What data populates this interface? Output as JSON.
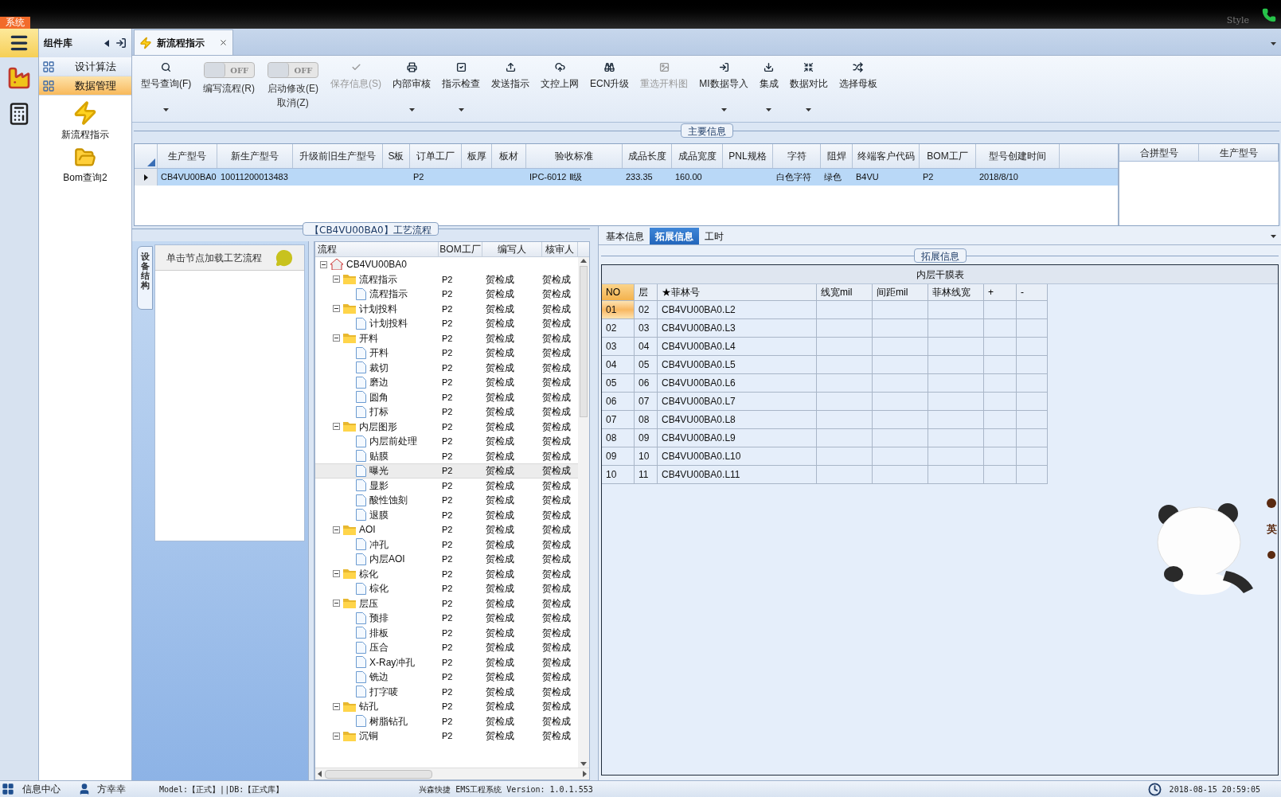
{
  "header": {
    "system_tab": "系统",
    "style_label": "Style"
  },
  "component_library": {
    "title": "组件库",
    "items": [
      {
        "label": "设计算法",
        "selected": false
      },
      {
        "label": "数据管理",
        "selected": true
      }
    ],
    "shortcuts": [
      {
        "label": "新流程指示",
        "kind": "bolt"
      },
      {
        "label": "Bom查询2",
        "kind": "folder"
      }
    ]
  },
  "document_tabs": [
    {
      "label": "新流程指示",
      "selected": true
    }
  ],
  "toolbar": [
    {
      "label": "型号查询(F)",
      "kind": "button",
      "disabled": false,
      "has_menu": true
    },
    {
      "label": "编写流程(R)",
      "kind": "toggle",
      "toggle_text": "OFF",
      "on": false
    },
    {
      "label": "启动修改(E)",
      "sublabel": "取消(Z)",
      "kind": "toggle",
      "toggle_text": "OFF",
      "on": false
    },
    {
      "label": "保存信息(S)",
      "kind": "button",
      "disabled": true,
      "has_menu": false
    },
    {
      "label": "内部审核",
      "kind": "button",
      "disabled": false,
      "has_menu": true
    },
    {
      "label": "指示检查",
      "kind": "button",
      "disabled": false,
      "has_menu": true
    },
    {
      "label": "发送指示",
      "kind": "button",
      "disabled": false,
      "has_menu": false
    },
    {
      "label": "文控上网",
      "kind": "button",
      "disabled": false,
      "has_menu": false
    },
    {
      "label": "ECN升级",
      "kind": "button",
      "disabled": false,
      "has_menu": false
    },
    {
      "label": "重选开料图",
      "kind": "button",
      "disabled": true,
      "has_menu": false
    },
    {
      "label": "MI数据导入",
      "kind": "button",
      "disabled": false,
      "has_menu": true
    },
    {
      "label": "集成",
      "kind": "button",
      "disabled": false,
      "has_menu": true
    },
    {
      "label": "数据对比",
      "kind": "button",
      "disabled": false,
      "has_menu": true
    },
    {
      "label": "选择母板",
      "kind": "button",
      "disabled": false,
      "has_menu": false
    }
  ],
  "main_info": {
    "title": "主要信息",
    "columns": [
      "生产型号",
      "新生产型号",
      "升级前旧生产型号",
      "S板",
      "订单工厂",
      "板厚",
      "板材",
      "验收标准",
      "成品长度",
      "成品宽度",
      "PNL规格",
      "字符",
      "阻焊",
      "终端客户代码",
      "BOM工厂",
      "型号创建时间"
    ],
    "rows": [
      {
        "selected": true,
        "cells": [
          "CB4VU00BA0",
          "10011200013483",
          null,
          null,
          "P2",
          null,
          null,
          "IPC-6012 Ⅱ级",
          "233.35",
          "160.00",
          null,
          "白色字符",
          "绿色",
          "B4VU",
          "P2",
          "2018/8/10"
        ]
      }
    ],
    "merge_table": {
      "columns": [
        "合拼型号",
        "生产型号"
      ]
    }
  },
  "process_panel": {
    "title": "【CB4VU00BA0】工艺流程",
    "side_tab": "设备结构",
    "hint": "单击节点加载工艺流程",
    "columns": [
      "流程",
      "BOM工厂",
      "编写人",
      "核审人"
    ],
    "tree": {
      "label": "CB4VU00BA0",
      "expanded": true,
      "selected": false,
      "children": [
        {
          "label": "流程指示",
          "bom": "P2",
          "author": "贺检成",
          "reviewer": "贺检成",
          "expanded": true,
          "selected": false,
          "children": [
            {
              "label": "流程指示",
              "bom": "P2",
              "author": "贺检成",
              "reviewer": "贺检成",
              "selected": false
            }
          ]
        },
        {
          "label": "计划投料",
          "bom": "P2",
          "author": "贺检成",
          "reviewer": "贺检成",
          "expanded": true,
          "selected": false,
          "children": [
            {
              "label": "计划投料",
              "bom": "P2",
              "author": "贺检成",
              "reviewer": "贺检成",
              "selected": false
            }
          ]
        },
        {
          "label": "开料",
          "bom": "P2",
          "author": "贺检成",
          "reviewer": "贺检成",
          "expanded": true,
          "selected": false,
          "children": [
            {
              "label": "开料",
              "bom": "P2",
              "author": "贺检成",
              "reviewer": "贺检成",
              "selected": false
            },
            {
              "label": "裁切",
              "bom": "P2",
              "author": "贺检成",
              "reviewer": "贺检成",
              "selected": false
            },
            {
              "label": "磨边",
              "bom": "P2",
              "author": "贺检成",
              "reviewer": "贺检成",
              "selected": false
            },
            {
              "label": "圆角",
              "bom": "P2",
              "author": "贺检成",
              "reviewer": "贺检成",
              "selected": false
            },
            {
              "label": "打标",
              "bom": "P2",
              "author": "贺检成",
              "reviewer": "贺检成",
              "selected": false
            }
          ]
        },
        {
          "label": "内层图形",
          "bom": "P2",
          "author": "贺检成",
          "reviewer": "贺检成",
          "expanded": true,
          "selected": false,
          "children": [
            {
              "label": "内层前处理",
              "bom": "P2",
              "author": "贺检成",
              "reviewer": "贺检成",
              "selected": false
            },
            {
              "label": "贴膜",
              "bom": "P2",
              "author": "贺检成",
              "reviewer": "贺检成",
              "selected": false
            },
            {
              "label": "曝光",
              "bom": "P2",
              "author": "贺检成",
              "reviewer": "贺检成",
              "selected": true
            },
            {
              "label": "显影",
              "bom": "P2",
              "author": "贺检成",
              "reviewer": "贺检成",
              "selected": false
            },
            {
              "label": "酸性蚀刻",
              "bom": "P2",
              "author": "贺检成",
              "reviewer": "贺检成",
              "selected": false
            },
            {
              "label": "退膜",
              "bom": "P2",
              "author": "贺检成",
              "reviewer": "贺检成",
              "selected": false
            }
          ]
        },
        {
          "label": "AOI",
          "bom": "P2",
          "author": "贺检成",
          "reviewer": "贺检成",
          "expanded": true,
          "selected": false,
          "children": [
            {
              "label": "冲孔",
              "bom": "P2",
              "author": "贺检成",
              "reviewer": "贺检成",
              "selected": false
            },
            {
              "label": "内层AOI",
              "bom": "P2",
              "author": "贺检成",
              "reviewer": "贺检成",
              "selected": false
            }
          ]
        },
        {
          "label": "棕化",
          "bom": "P2",
          "author": "贺检成",
          "reviewer": "贺检成",
          "expanded": true,
          "selected": false,
          "children": [
            {
              "label": "棕化",
              "bom": "P2",
              "author": "贺检成",
              "reviewer": "贺检成",
              "selected": false
            }
          ]
        },
        {
          "label": "层压",
          "bom": "P2",
          "author": "贺检成",
          "reviewer": "贺检成",
          "expanded": true,
          "selected": false,
          "children": [
            {
              "label": "预排",
              "bom": "P2",
              "author": "贺检成",
              "reviewer": "贺检成",
              "selected": false
            },
            {
              "label": "排板",
              "bom": "P2",
              "author": "贺检成",
              "reviewer": "贺检成",
              "selected": false
            },
            {
              "label": "压合",
              "bom": "P2",
              "author": "贺检成",
              "reviewer": "贺检成",
              "selected": false
            },
            {
              "label": "X-Ray冲孔",
              "bom": "P2",
              "author": "贺检成",
              "reviewer": "贺检成",
              "selected": false
            },
            {
              "label": "铣边",
              "bom": "P2",
              "author": "贺检成",
              "reviewer": "贺检成",
              "selected": false
            },
            {
              "label": "打字唛",
              "bom": "P2",
              "author": "贺检成",
              "reviewer": "贺检成",
              "selected": false
            }
          ]
        },
        {
          "label": "钻孔",
          "bom": "P2",
          "author": "贺检成",
          "reviewer": "贺检成",
          "expanded": true,
          "selected": false,
          "children": [
            {
              "label": "树脂钻孔",
              "bom": "P2",
              "author": "贺检成",
              "reviewer": "贺检成",
              "selected": false
            }
          ]
        },
        {
          "label": "沉铜",
          "bom": "P2",
          "author": "贺检成",
          "reviewer": "贺检成",
          "expanded": true,
          "selected": false
        }
      ]
    }
  },
  "detail_panel": {
    "tabs": [
      {
        "label": "基本信息",
        "selected": false
      },
      {
        "label": "拓展信息",
        "selected": true
      },
      {
        "label": "工时",
        "selected": false
      }
    ],
    "group_title": "拓展信息",
    "table_title": "内层干膜表",
    "columns": [
      "NO",
      "层",
      "★菲林号",
      "线宽mil",
      "间距mil",
      "菲林线宽",
      "+",
      "-"
    ],
    "rows": [
      {
        "current": true,
        "cells": [
          "01",
          "02",
          "CB4VU00BA0.L2"
        ]
      },
      {
        "current": false,
        "cells": [
          "02",
          "03",
          "CB4VU00BA0.L3"
        ]
      },
      {
        "current": false,
        "cells": [
          "03",
          "04",
          "CB4VU00BA0.L4"
        ]
      },
      {
        "current": false,
        "cells": [
          "04",
          "05",
          "CB4VU00BA0.L5"
        ]
      },
      {
        "current": false,
        "cells": [
          "05",
          "06",
          "CB4VU00BA0.L6"
        ]
      },
      {
        "current": false,
        "cells": [
          "06",
          "07",
          "CB4VU00BA0.L7"
        ]
      },
      {
        "current": false,
        "cells": [
          "07",
          "08",
          "CB4VU00BA0.L8"
        ]
      },
      {
        "current": false,
        "cells": [
          "08",
          "09",
          "CB4VU00BA0.L9"
        ]
      },
      {
        "current": false,
        "cells": [
          "09",
          "10",
          "CB4VU00BA0.L10"
        ]
      },
      {
        "current": false,
        "cells": [
          "10",
          "11",
          "CB4VU00BA0.L11"
        ]
      }
    ]
  },
  "ime_widget": {
    "label": "英"
  },
  "status_bar": {
    "message_center": "信息中心",
    "user": "方幸幸",
    "mode": "Model:【正式】||DB:【正式库】",
    "app": "兴森快捷 EMS工程系统 Version: 1.0.1.553",
    "datetime": "2018-08-15 20:59:05"
  }
}
